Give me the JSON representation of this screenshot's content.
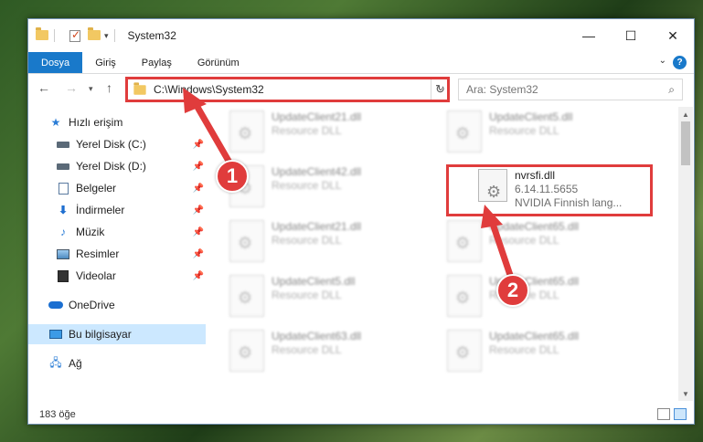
{
  "window": {
    "title": "System32",
    "controls": {
      "minimize": "—",
      "maximize": "☐",
      "close": "✕"
    }
  },
  "ribbon": {
    "tabs": [
      "Dosya",
      "Giriş",
      "Paylaş",
      "Görünüm"
    ],
    "help": "?"
  },
  "address": {
    "path": "C:\\Windows\\System32",
    "search_placeholder": "Ara: System32"
  },
  "sidebar": {
    "quick_access": "Hızlı erişim",
    "items": [
      {
        "label": "Yerel Disk (C:)",
        "icon": "drive-icon",
        "pinned": true
      },
      {
        "label": "Yerel Disk (D:)",
        "icon": "drive-icon",
        "pinned": true
      },
      {
        "label": "Belgeler",
        "icon": "document-icon",
        "pinned": true
      },
      {
        "label": "İndirmeler",
        "icon": "download-icon",
        "pinned": true
      },
      {
        "label": "Müzik",
        "icon": "music-icon",
        "pinned": true
      },
      {
        "label": "Resimler",
        "icon": "pictures-icon",
        "pinned": true
      },
      {
        "label": "Videolar",
        "icon": "videos-icon",
        "pinned": true
      }
    ],
    "onedrive": "OneDrive",
    "this_pc": "Bu bilgisayar",
    "network": "Ağ"
  },
  "files": {
    "left_column": [
      {
        "name": "UpdateClient21.dll",
        "type": "Resource DLL"
      },
      {
        "name": "UpdateClient42.dll",
        "type": "Resource DLL"
      },
      {
        "name": "UpdateClient21.dll",
        "type": "Resource DLL"
      },
      {
        "name": "UpdateClient5.dll",
        "type": "Resource DLL"
      },
      {
        "name": "UpdateClient63.dll",
        "type": "Resource DLL"
      }
    ],
    "right_column": [
      {
        "name": "UpdateClient5.dll",
        "type": "Resource DLL"
      },
      {
        "name": "UpdateClient65.dll",
        "type": "Resource DLL"
      },
      {
        "name": "UpdateClient65.dll",
        "type": "Resource DLL"
      },
      {
        "name": "UpdateClient65.dll",
        "type": "Resource DLL"
      }
    ],
    "highlighted": {
      "name": "nvrsfi.dll",
      "version": "6.14.11.5655",
      "description": "NVIDIA Finnish lang..."
    }
  },
  "status": {
    "item_count": "183 öğe"
  },
  "annotations": {
    "step1": "1",
    "step2": "2",
    "color": "#e03c3c"
  }
}
